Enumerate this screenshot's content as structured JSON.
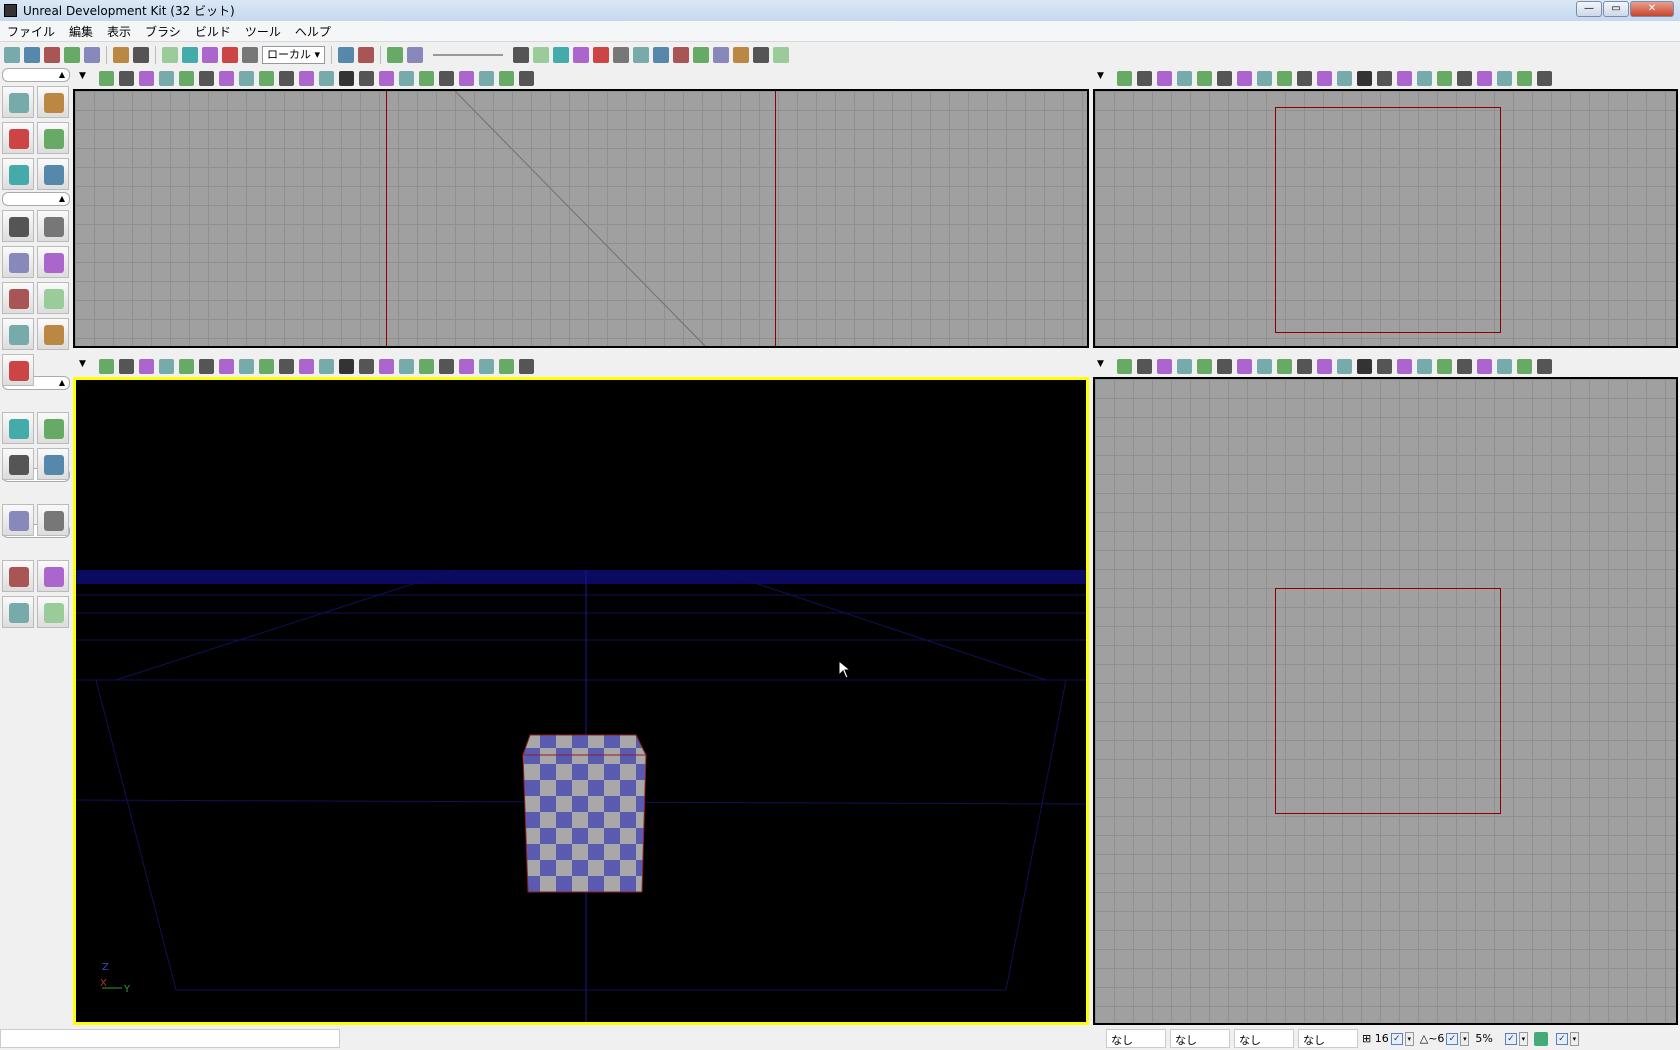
{
  "window": {
    "title": "Unreal Development Kit (32 ビット)",
    "minimize": "—",
    "maximize": "▭",
    "close": "✕"
  },
  "menu": [
    "ファイル",
    "編集",
    "表示",
    "ブラシ",
    "ビルド",
    "ツール",
    "ヘルプ"
  ],
  "toolbar": {
    "coord_system": "ローカル",
    "icons": [
      "new-file",
      "open-folder",
      "open-dropdown",
      "save",
      "save-all",
      "undo",
      "redo",
      "select",
      "translate",
      "rotate",
      "scale",
      "scale-nonuniform",
      "coord-combo",
      "find",
      "matinee",
      "kismet",
      "content-browser",
      "speed-slider",
      "generic-browser",
      "red-slash",
      "play-p",
      "drop",
      "particles",
      "sphere",
      "lightbulb",
      "path",
      "path2",
      "lighting",
      "bulb2",
      "build-all",
      "actor",
      "actor2"
    ]
  },
  "viewport_toolbar_icons": [
    "dropdown",
    "camera-pawn",
    "wireframe",
    "brush-wireframe",
    "unlit",
    "lit",
    "detail-lighting",
    "lighting-only",
    "light-complexity",
    "shader-complexity",
    "texture-density",
    "lightmap-density",
    "lit-lightmaps",
    "game-view-G",
    "lock",
    "eye",
    "actor-realtime",
    "actor-red",
    "stat-S",
    "maximize-frame",
    "pawn",
    "float-view",
    "maximize"
  ],
  "viewports": [
    {
      "name": "top-left",
      "mode": "side-ortho",
      "active": false
    },
    {
      "name": "top-right",
      "mode": "top-ortho",
      "active": false
    },
    {
      "name": "bottom-left",
      "mode": "perspective",
      "active": true,
      "axis": {
        "z": "Z",
        "x": "X",
        "y": "Y"
      }
    },
    {
      "name": "bottom-right",
      "mode": "front-ortho",
      "active": false
    }
  ],
  "colors": {
    "grid_bg": "#a0a0a0",
    "active_border": "#ffff00",
    "brush_red": "#8b0000",
    "persp_bg": "#000000",
    "cube_blue": "#5a5ab0",
    "cube_gray": "#a8a8a8"
  },
  "status": {
    "fields": [
      "なし",
      "なし",
      "なし",
      "なし"
    ],
    "grid_snap": "16",
    "rot_snap": "~6",
    "scale_snap": "5%",
    "checkboxes": [
      true,
      true,
      true,
      true
    ]
  }
}
